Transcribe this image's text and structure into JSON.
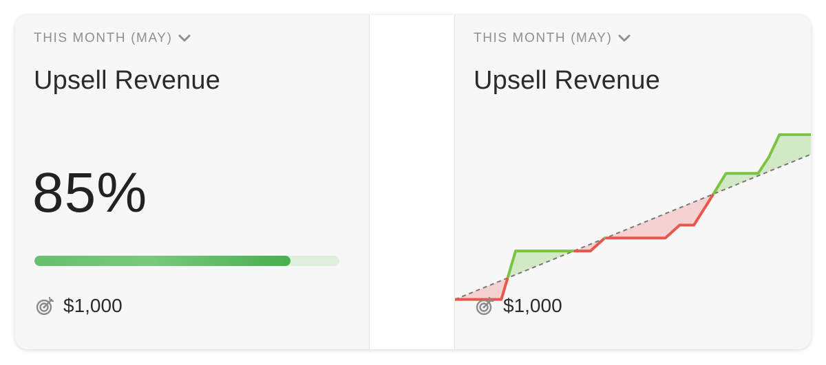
{
  "cards": [
    {
      "period_label": "THIS MONTH (MAY)",
      "title": "Upsell Revenue",
      "percent_text": "85%",
      "progress_fraction": 0.84,
      "target_text": "$1,000"
    },
    {
      "period_label": "THIS MONTH (MAY)",
      "title": "Upsell Revenue",
      "target_text": "$1,000"
    }
  ],
  "colors": {
    "ahead": "#7cc243",
    "behind": "#e8574c",
    "ahead_fill": "#c4e6b4",
    "behind_fill": "#f4c4c4",
    "target_line": "#777777",
    "progress": "#55b75b"
  },
  "chart_data": {
    "type": "line",
    "title": "",
    "xlabel": "",
    "ylabel": "",
    "grid": false,
    "xlim": [
      0,
      1
    ],
    "ylim": [
      0,
      1
    ],
    "target_line": {
      "x": [
        0,
        1
      ],
      "y": [
        0.12,
        0.57
      ]
    },
    "series": [
      {
        "x": [
          0,
          0.13,
          0.17,
          0.24,
          0.38,
          0.42,
          0.59,
          0.63,
          0.67,
          0.71,
          0.76,
          0.79,
          0.84,
          0.85,
          0.88,
          0.91,
          1
        ],
        "y": [
          0.12,
          0.12,
          0.27,
          0.27,
          0.27,
          0.31,
          0.31,
          0.35,
          0.35,
          0.42,
          0.51,
          0.51,
          0.51,
          0.51,
          0.56,
          0.63,
          0.63
        ]
      }
    ]
  }
}
